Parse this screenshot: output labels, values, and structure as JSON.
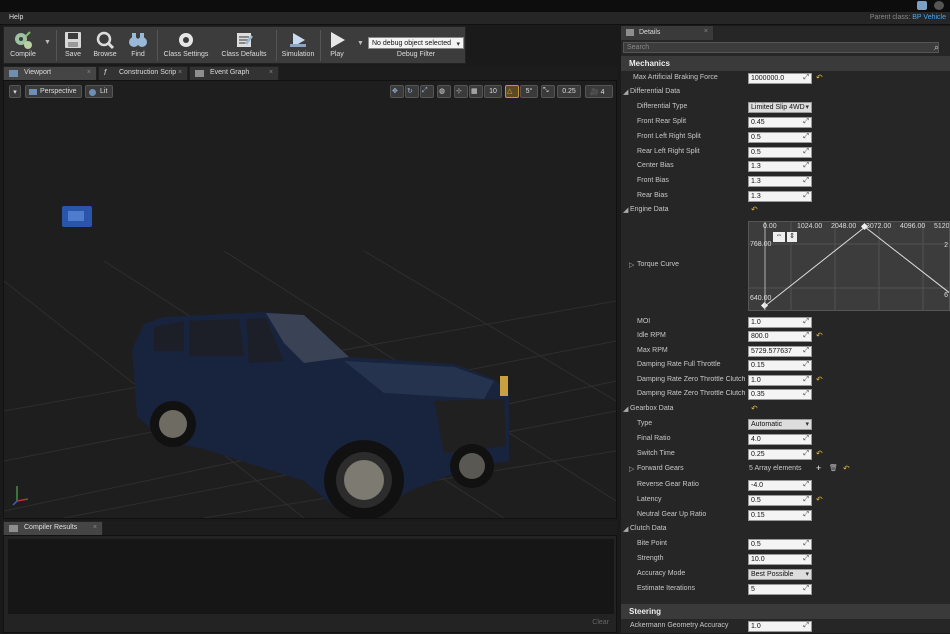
{
  "menu": {
    "help": "Help"
  },
  "parent_class": {
    "label": "Parent class:",
    "value": "BP Vehicle"
  },
  "toolbar": {
    "compile": "Compile",
    "save": "Save",
    "browse": "Browse",
    "find": "Find",
    "class_settings": "Class Settings",
    "class_defaults": "Class Defaults",
    "simulation": "Simulation",
    "play": "Play",
    "debug_selected": "No debug object selected",
    "debug_filter": "Debug Filter"
  },
  "tabs": {
    "viewport": "Viewport",
    "construction": "Construction Scrip",
    "event_graph": "Event Graph"
  },
  "viewport": {
    "perspective": "Perspective",
    "lit": "Lit",
    "grid_snap": "10",
    "rot_snap": "5°",
    "scale_snap": "0.25",
    "cam_speed": "4"
  },
  "compiler": {
    "tab": "Compiler Results",
    "clear": "Clear"
  },
  "details": {
    "tab": "Details",
    "search_placeholder": "Search",
    "mechanics": "Mechanics",
    "max_braking_label": "Max Artificial Braking Force",
    "max_braking_value": "1000000.0",
    "differential": "Differential Data",
    "diff_type_label": "Differential Type",
    "diff_type_value": "Limited Slip 4WD",
    "front_rear_label": "Front Rear Split",
    "front_rear_value": "0.45",
    "front_lr_label": "Front Left Right Split",
    "front_lr_value": "0.5",
    "rear_lr_label": "Rear Left Right Split",
    "rear_lr_value": "0.5",
    "center_bias_label": "Center Bias",
    "center_bias_value": "1.3",
    "front_bias_label": "Front Bias",
    "front_bias_value": "1.3",
    "rear_bias_label": "Rear Bias",
    "rear_bias_value": "1.3",
    "engine": "Engine Data",
    "torque_label": "Torque Curve",
    "curve_x": [
      "0.00",
      "1024.00",
      "2048.00",
      "3072.00",
      "4096.00",
      "5120"
    ],
    "curve_y_top": "768.00",
    "curve_y_bot": "640.00",
    "curve_y_right_top": "2",
    "curve_y_right_bot": "6",
    "moi_label": "MOI",
    "moi_value": "1.0",
    "idle_label": "Idle RPM",
    "idle_value": "800.0",
    "max_rpm_label": "Max RPM",
    "max_rpm_value": "5729.577637",
    "damp_full_label": "Damping Rate Full Throttle",
    "damp_full_value": "0.15",
    "damp_zero_clutch_label": "Damping Rate Zero Throttle Clutch E",
    "damp_zero_clutch_value": "1.0",
    "damp_zero_clutch2_label": "Damping Rate Zero Throttle Clutch D",
    "damp_zero_clutch2_value": "0.35",
    "gearbox": "Gearbox Data",
    "type_label": "Type",
    "type_value": "Automatic",
    "final_ratio_label": "Final Ratio",
    "final_ratio_value": "4.0",
    "switch_time_label": "Switch Time",
    "switch_time_value": "0.25",
    "forward_gears_label": "Forward Gears",
    "forward_gears_value": "5 Array elements",
    "reverse_label": "Reverse Gear Ratio",
    "reverse_value": "-4.0",
    "latency_label": "Latency",
    "latency_value": "0.5",
    "neutral_label": "Neutral Gear Up Ratio",
    "neutral_value": "0.15",
    "clutch": "Clutch Data",
    "bite_label": "Bite Point",
    "bite_value": "0.5",
    "strength_label": "Strength",
    "strength_value": "10.0",
    "accuracy_mode_label": "Accuracy Mode",
    "accuracy_mode_value": "Best Possible",
    "est_iter_label": "Estimate Iterations",
    "est_iter_value": "5",
    "steering": "Steering",
    "ackermann_label": "Ackermann Geometry Accuracy",
    "ackermann_value": "1.0"
  }
}
